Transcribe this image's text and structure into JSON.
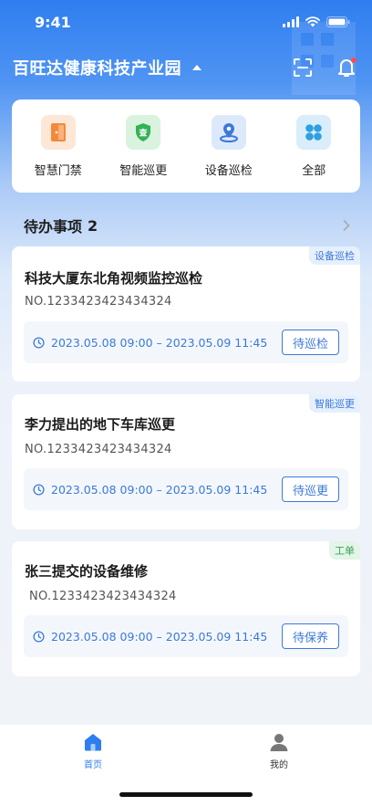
{
  "status_bar": {
    "time": "9:41"
  },
  "header": {
    "park_name": "百旺达健康科技产业园",
    "icons": [
      "caret-up-icon",
      "scan-icon",
      "bell-icon"
    ]
  },
  "quick_menu": {
    "items": [
      {
        "label": "智慧门禁",
        "icon": "door-icon",
        "color": "#f28a3c"
      },
      {
        "label": "智能巡更",
        "icon": "shield-check-icon",
        "color": "#34b255"
      },
      {
        "label": "设备巡检",
        "icon": "map-pin-icon",
        "color": "#3c79d8"
      },
      {
        "label": "全部",
        "icon": "grid-icon",
        "color": "#2fa0e0"
      }
    ]
  },
  "todo": {
    "title": "待办事项",
    "count": "2",
    "cards": [
      {
        "tag": "设备巡检",
        "title": "科技大厦东北角视频监控巡检",
        "number": "NO.1233423423434324",
        "time": "2023.05.08 09:00 – 2023.05.09 11:45",
        "status": "待巡检"
      },
      {
        "tag": "智能巡更",
        "title": "李力提出的地下车库巡更",
        "number": "NO.1233423423434324",
        "time": "2023.05.08 09:00 – 2023.05.09 11:45",
        "status": "待巡更"
      },
      {
        "tag": "工单",
        "title": "张三提交的设备维修",
        "number": "NO.1233423423434324",
        "time": "2023.05.08 09:00 – 2023.05.09 11:45",
        "status": "待保养"
      }
    ]
  },
  "tab_bar": {
    "tabs": [
      {
        "label": "首页",
        "icon": "home-icon",
        "active": true
      },
      {
        "label": "我的",
        "icon": "user-icon",
        "active": false
      }
    ]
  },
  "colors": {
    "primary": "#2f7ef0",
    "accent_blue": "#3c79d8",
    "tag_green": "#3aa45a"
  }
}
